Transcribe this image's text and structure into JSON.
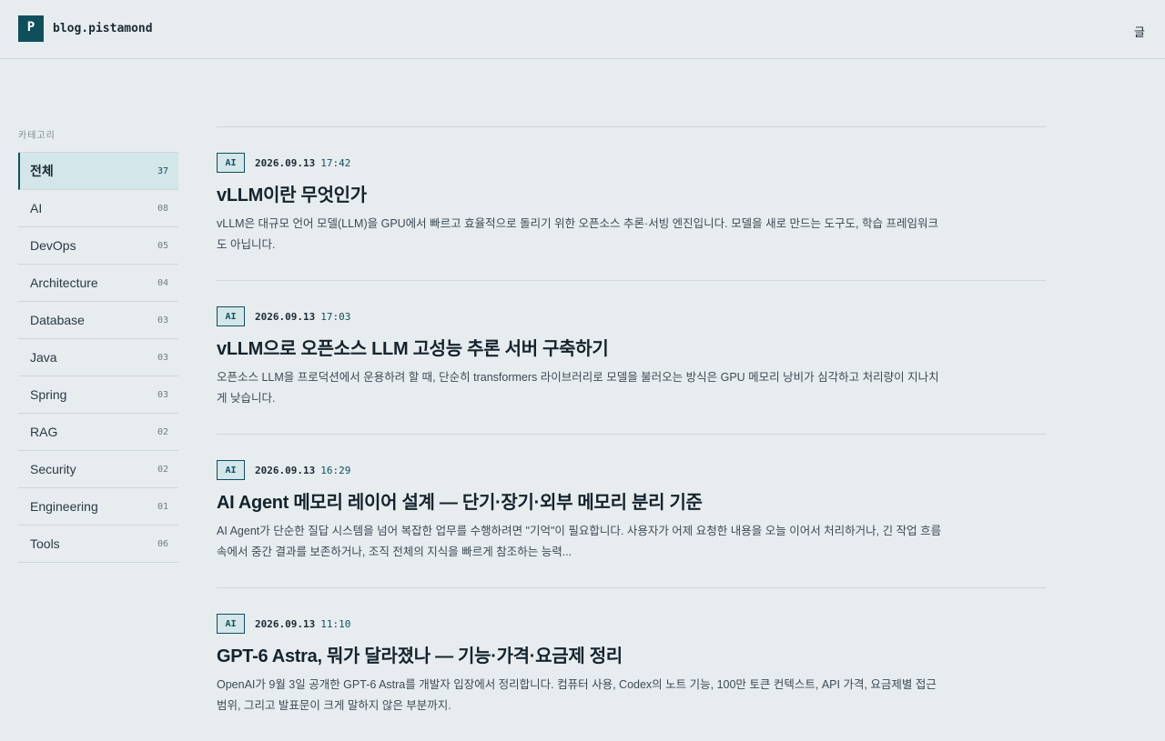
{
  "header": {
    "logo_letter": "P",
    "site_name": "blog.pistamond",
    "menu_glyph": "글"
  },
  "sidebar": {
    "title": "카테고리",
    "categories": [
      {
        "label": "전체",
        "count": "37",
        "active": true
      },
      {
        "label": "AI",
        "count": "08"
      },
      {
        "label": "DevOps",
        "count": "05"
      },
      {
        "label": "Architecture",
        "count": "04"
      },
      {
        "label": "Database",
        "count": "03"
      },
      {
        "label": "Java",
        "count": "03"
      },
      {
        "label": "Spring",
        "count": "03"
      },
      {
        "label": "RAG",
        "count": "02"
      },
      {
        "label": "Security",
        "count": "02"
      },
      {
        "label": "Engineering",
        "count": "01"
      },
      {
        "label": "Tools",
        "count": "06"
      }
    ]
  },
  "posts": [
    {
      "tag": "AI",
      "date": "2026.09.13",
      "time": "17:42",
      "title": "vLLM이란 무엇인가",
      "excerpt": "vLLM은 대규모 언어 모델(LLM)을 GPU에서 빠르고 효율적으로 돌리기 위한 오픈소스 추론·서빙 엔진입니다. 모델을 새로 만드는 도구도, 학습 프레임워크도 아닙니다."
    },
    {
      "tag": "AI",
      "date": "2026.09.13",
      "time": "17:03",
      "title": "vLLM으로 오픈소스 LLM 고성능 추론 서버 구축하기",
      "excerpt": "오픈소스 LLM을 프로덕션에서 운용하려 할 때, 단순히 transformers 라이브러리로 모델을 불러오는 방식은 GPU 메모리 낭비가 심각하고 처리량이 지나치게 낮습니다."
    },
    {
      "tag": "AI",
      "date": "2026.09.13",
      "time": "16:29",
      "title": "AI Agent 메모리 레이어 설계 — 단기·장기·외부 메모리 분리 기준",
      "excerpt": "AI Agent가 단순한 질답 시스템을 넘어 복잡한 업무를 수행하려면 \"기억\"이 필요합니다. 사용자가 어제 요청한 내용을 오늘 이어서 처리하거나, 긴 작업 흐름 속에서 중간 결과를 보존하거나, 조직 전체의 지식을 빠르게 참조하는 능력..."
    },
    {
      "tag": "AI",
      "date": "2026.09.13",
      "time": "11:10",
      "title": "GPT-6 Astra, 뭐가 달라졌나 — 기능·가격·요금제 정리",
      "excerpt": "OpenAI가 9월 3일 공개한 GPT-6 Astra를 개발자 입장에서 정리합니다. 컴퓨터 사용, Codex의 노트 기능, 100만 토큰 컨텍스트, API 가격, 요금제별 접근 범위, 그리고 발표문이 크게 말하지 않은 부분까지."
    }
  ]
}
